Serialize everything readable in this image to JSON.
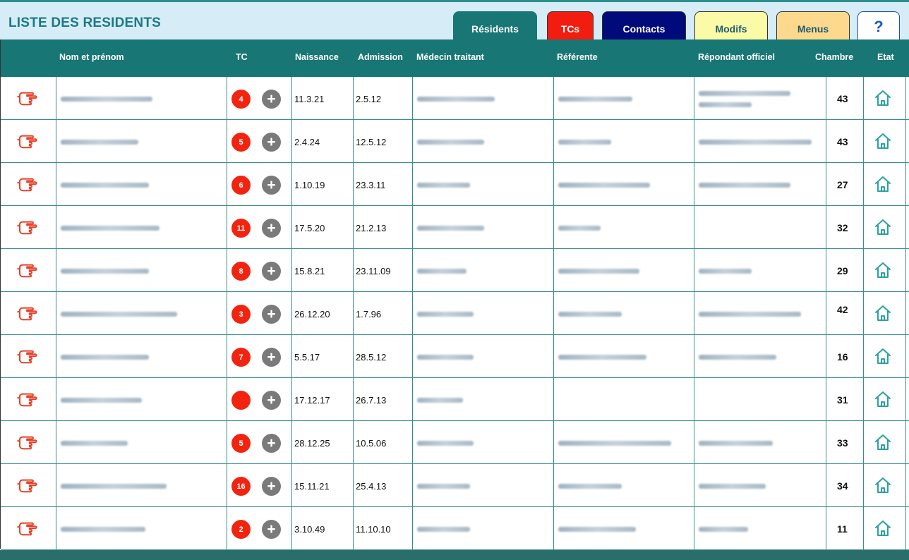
{
  "header": {
    "title": "LISTE DES RESIDENTS",
    "tabs": [
      {
        "label": "Résidents",
        "color": "#187674"
      },
      {
        "label": "TCs",
        "color": "#f21c0f"
      },
      {
        "label": "Contacts",
        "color": "#000a7a"
      },
      {
        "label": "Modifs",
        "color": "#fbfaa6"
      },
      {
        "label": "Menus",
        "color": "#fcd98d"
      }
    ],
    "help_label": "?"
  },
  "table": {
    "columns": {
      "nom": "Nom et prénom",
      "tc": "TC",
      "naissance": "Naissance",
      "admission": "Admission",
      "medecin": "Médecin traitant",
      "referente": "Référente",
      "repondant": "Répondant officiel",
      "chambre": "Chambre",
      "etat": "Etat"
    },
    "rows": [
      {
        "tc": "4",
        "naissance": "11.3.21",
        "admission": "2.5.12",
        "chambre": "43"
      },
      {
        "tc": "5",
        "naissance": "2.4.24",
        "admission": "12.5.12",
        "chambre": "43"
      },
      {
        "tc": "6",
        "naissance": "1.10.19",
        "admission": "23.3.11",
        "chambre": "27"
      },
      {
        "tc": "11",
        "naissance": "17.5.20",
        "admission": "21.2.13",
        "chambre": "32"
      },
      {
        "tc": "8",
        "naissance": "15.8.21",
        "admission": "23.11.09",
        "chambre": "29"
      },
      {
        "tc": "3",
        "naissance": "26.12.20",
        "admission": "1.7.96",
        "chambre": "42"
      },
      {
        "tc": "7",
        "naissance": "5.5.17",
        "admission": "28.5.12",
        "chambre": "16"
      },
      {
        "tc": "",
        "naissance": "17.12.17",
        "admission": "26.7.13",
        "chambre": "31"
      },
      {
        "tc": "5",
        "naissance": "28.12.25",
        "admission": "10.5.06",
        "chambre": "33"
      },
      {
        "tc": "16",
        "naissance": "15.11.21",
        "admission": "25.4.13",
        "chambre": "34"
      },
      {
        "tc": "2",
        "naissance": "3.10.49",
        "admission": "11.10.10",
        "chambre": "11"
      }
    ]
  },
  "icons": {
    "row_action": "pointing-hand-icon",
    "add": "plus-icon",
    "etat": "home-icon"
  },
  "colors": {
    "accent": "#187674",
    "badge": "#f2240f",
    "pointer": "#e8412a",
    "home": "#2aa29c"
  }
}
